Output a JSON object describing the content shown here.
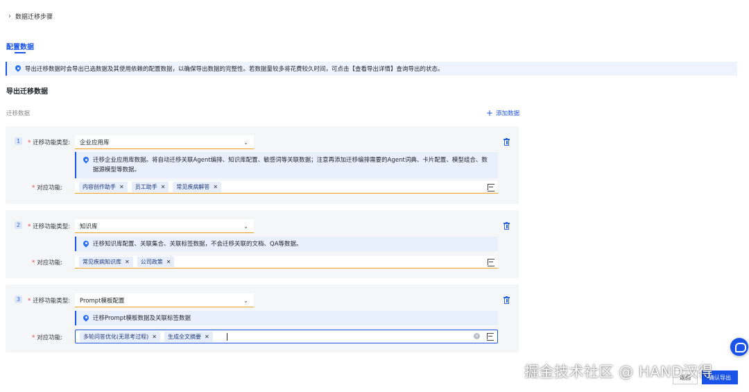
{
  "breadcrumb": {
    "label": "数据迁移步骤"
  },
  "tabs": [
    {
      "label": "配置数据"
    }
  ],
  "notice": {
    "text": "导出迁移数据时会导出已选数据及其使用依赖的配置数据，以确保导出数据的完整性。若数据量较多将花费较久时间，可点击【查看导出详情】查询导出的状态。"
  },
  "section": {
    "title": "导出迁移数据",
    "sub_label": "迁移数据",
    "add_label": "添加数据"
  },
  "labels": {
    "type": "迁移功能类型:",
    "func": "对应功能:",
    "required": "*"
  },
  "cards": [
    {
      "index": "1",
      "type_value": "企业应用库",
      "hint": "迁移企业应用库数据。将自动迁移关联Agent编排、知识库配置、敏感词等关联数据；注意再添加迁移编排需要的Agent词典、卡片配置、模型组合、数据源模型等数据。",
      "tags": [
        "内容创作助手",
        "员工助手",
        "常见疾病解答"
      ]
    },
    {
      "index": "2",
      "type_value": "知识库",
      "hint": "迁移知识库配置、关联集合、关联标签数据，不会迁移关联的文档、QA等数据。",
      "tags": [
        "常见疾病知识库",
        "公司政策"
      ]
    },
    {
      "index": "3",
      "type_value": "Prompt模板配置",
      "hint": "迁移Prompt模板数据及关联标签数据",
      "tags": [
        "多轮问答优化(无思考过程)",
        "生成全文摘要"
      ]
    }
  ],
  "footer": {
    "watermark": "掘金技术社区 @ HAND汉得",
    "back_label": "返回",
    "confirm_label": "确认导出"
  },
  "colors": {
    "accent": "#1a53e8",
    "required": "#e54545",
    "focus_underline": "#f0a020"
  },
  "icons": [
    "chevron-right-icon",
    "location-pin-icon",
    "plus-icon",
    "trash-icon",
    "chevron-down-icon",
    "close-icon",
    "list-icon",
    "clear-icon",
    "chat-icon"
  ]
}
